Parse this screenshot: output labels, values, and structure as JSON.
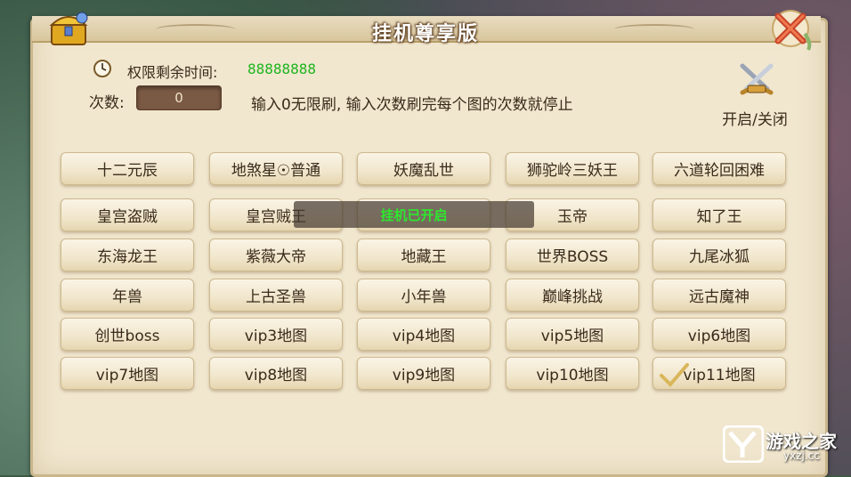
{
  "window": {
    "title": "挂机尊享版"
  },
  "timer": {
    "label": "权限剩余时间:",
    "value": "88888888",
    "icon": "clock-icon"
  },
  "count": {
    "label": "次数:",
    "value": "0",
    "hint": "输入0无限刷, 输入次数刷完每个图的次数就停止"
  },
  "toggle": {
    "label": "开启/关闭",
    "icon": "crossed-swords-icon"
  },
  "toast": {
    "text": "挂机已开启"
  },
  "maps": [
    [
      "十二元辰",
      "地煞星☉普通",
      "妖魔乱世",
      "狮驼岭三妖王",
      "六道轮回困难"
    ],
    [
      "皇宫盗贼",
      "皇宫贼王",
      "",
      "玉帝",
      "知了王"
    ],
    [
      "东海龙王",
      "紫薇大帝",
      "地藏王",
      "世界BOSS",
      "九尾冰狐"
    ],
    [
      "年兽",
      "上古圣兽",
      "小年兽",
      "巅峰挑战",
      "远古魔神"
    ],
    [
      "创世boss",
      "vip3地图",
      "vip4地图",
      "vip5地图",
      "vip6地图"
    ],
    [
      "vip7地图",
      "vip8地图",
      "vip9地图",
      "vip10地图",
      "vip11地图"
    ]
  ],
  "checked_map": "vip11地图",
  "watermark": {
    "name": "游戏之家",
    "url": "yxzj.cc"
  },
  "colors": {
    "panel": "#f1e7cf",
    "timer_value": "#1fb51f",
    "toast_text": "#2ee82e",
    "input_bg": "#7a5a44"
  }
}
